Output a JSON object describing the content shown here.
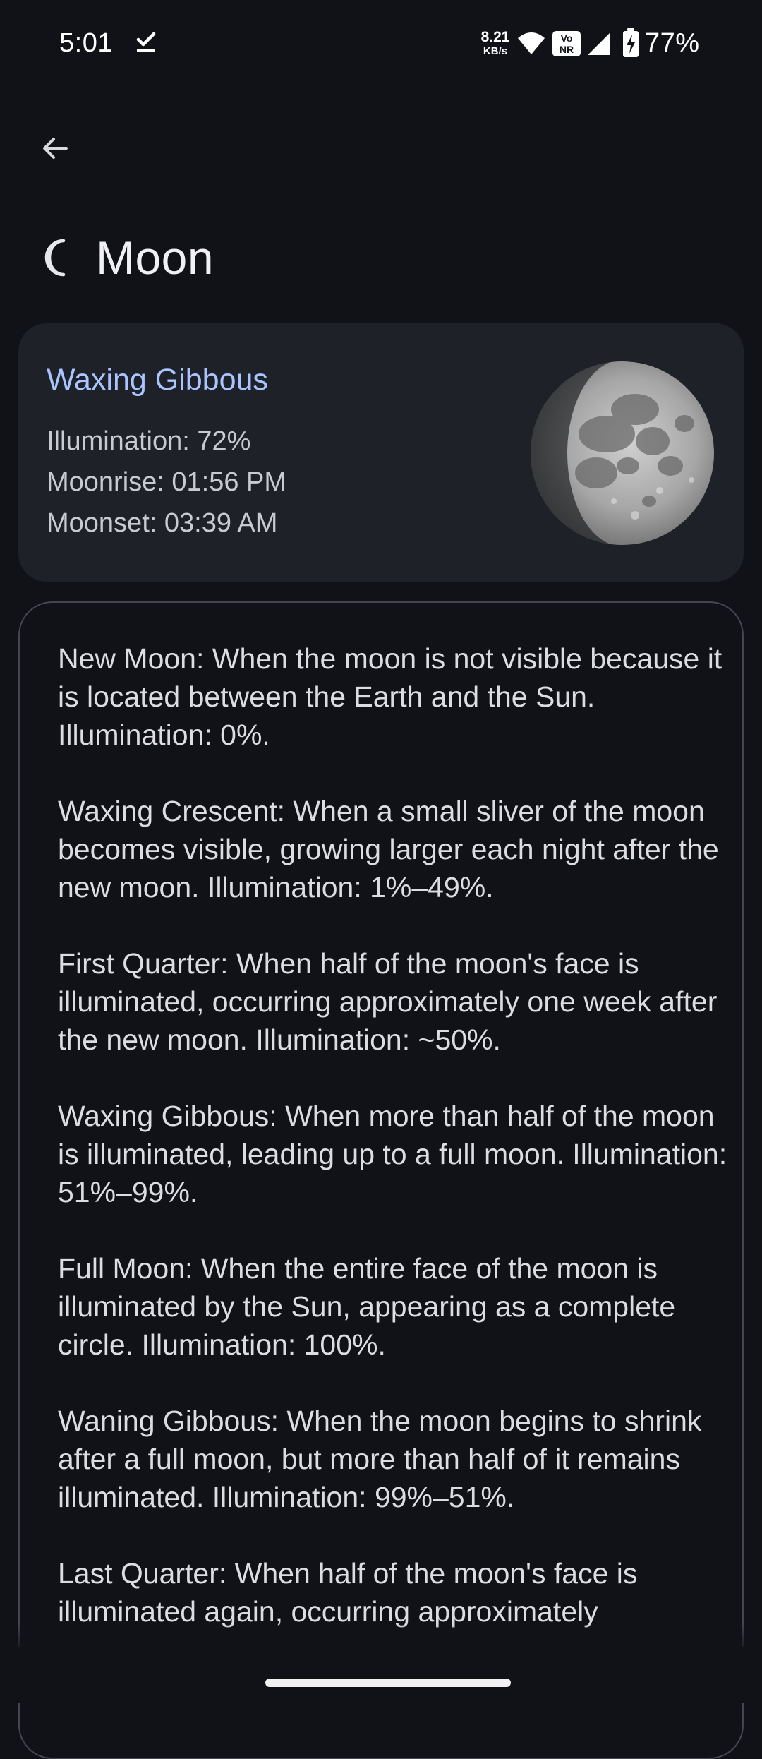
{
  "status_bar": {
    "time": "5:01",
    "net_speed_value": "8.21",
    "net_speed_unit": "KB/s",
    "vonr_label_top": "Vo",
    "vonr_label_bottom": "NR",
    "battery_percent": "77%"
  },
  "header": {
    "title": "Moon",
    "icon": "crescent-moon-icon"
  },
  "summary": {
    "phase_name": "Waxing Gibbous",
    "illumination": "Illumination: 72%",
    "moonrise": "Moonrise: 01:56 PM",
    "moonset": "Moonset: 03:39 AM",
    "illumination_fraction": 0.72
  },
  "descriptions": [
    "New Moon: When the moon is not visible because it is located between the Earth and the Sun. Illumination: 0%.",
    "Waxing Crescent: When a small sliver of the moon becomes visible, growing larger each night after the new moon. Illumination: 1%–49%.",
    "First Quarter: When half of the moon's face is illuminated, occurring approximately one week after the new moon. Illumination: ~50%.",
    "Waxing Gibbous: When more than half of the moon is illuminated, leading up to a full moon. Illumination: 51%–99%.",
    "Full Moon: When the entire face of the moon is illuminated by the Sun, appearing as a complete circle. Illumination: 100%.",
    "Waning Gibbous: When the moon begins to shrink after a full moon, but more than half of it remains illuminated. Illumination: 99%–51%.",
    "Last Quarter: When half of the moon's face is illuminated again, occurring approximately"
  ],
  "colors": {
    "background": "#111217",
    "card": "#1f2128",
    "accent": "#a9c4ff"
  }
}
